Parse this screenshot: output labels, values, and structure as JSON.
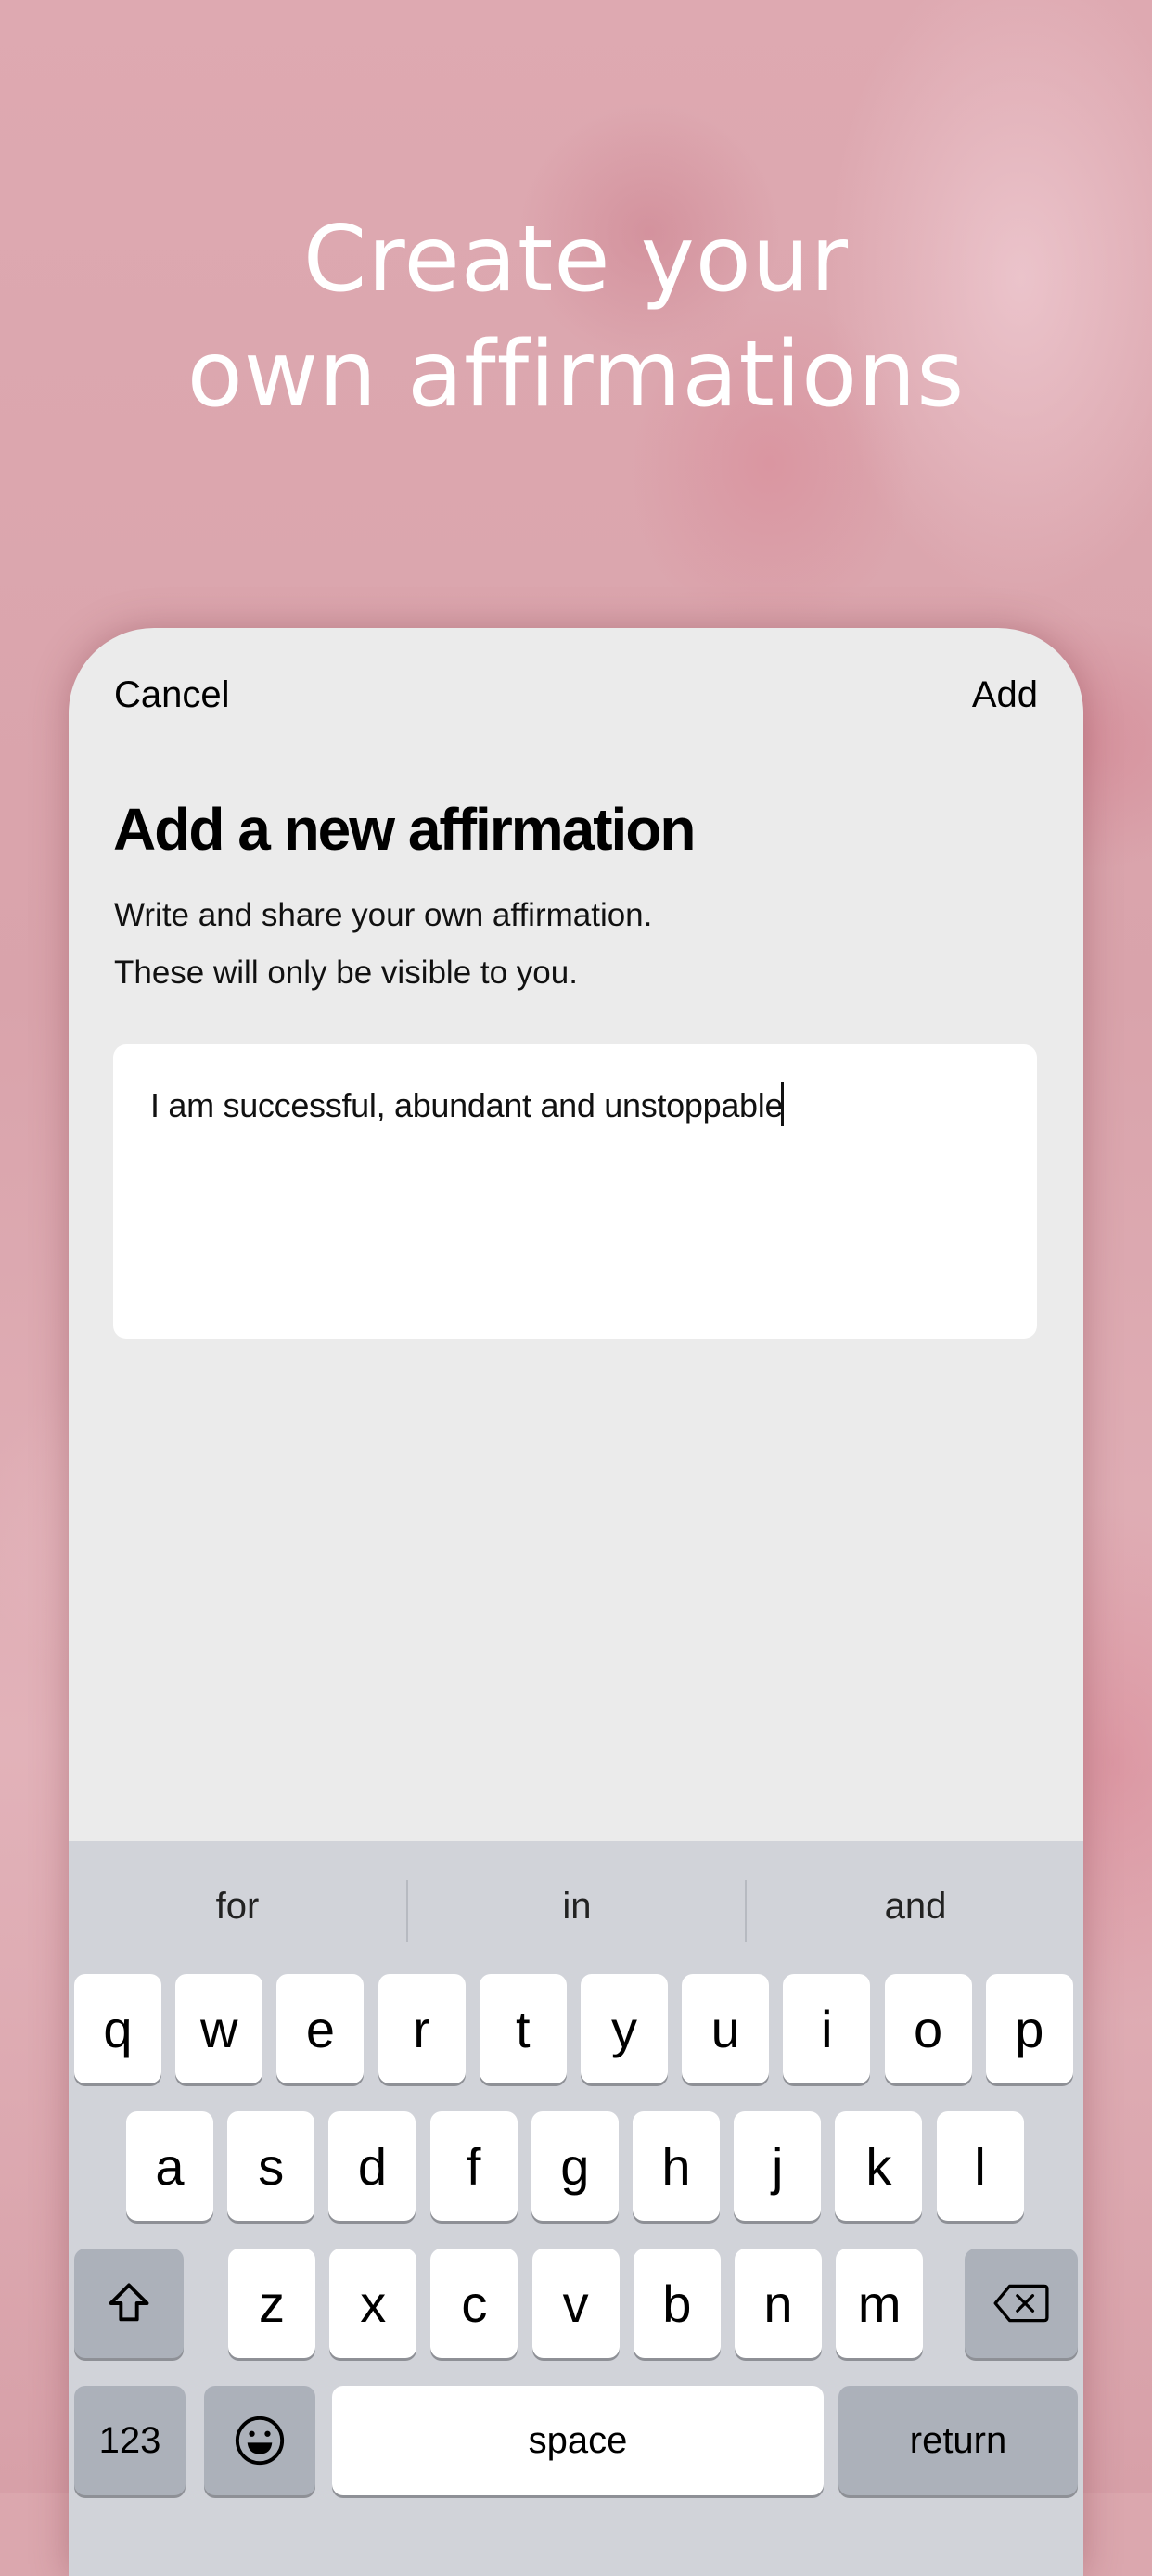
{
  "headline": {
    "line1": "Create your",
    "line2": "own affirmations"
  },
  "sheet": {
    "cancel_label": "Cancel",
    "add_label": "Add",
    "title": "Add a new affirmation",
    "subtitle_line1": "Write and share your own affirmation.",
    "subtitle_line2": "These will only be visible to you.",
    "input_value": "I am successful, abundant and unstoppable"
  },
  "keyboard": {
    "suggestions": [
      "for",
      "in",
      "and"
    ],
    "row1": [
      "q",
      "w",
      "e",
      "r",
      "t",
      "y",
      "u",
      "i",
      "o",
      "p"
    ],
    "row2": [
      "a",
      "s",
      "d",
      "f",
      "g",
      "h",
      "j",
      "k",
      "l"
    ],
    "row3": [
      "z",
      "x",
      "c",
      "v",
      "b",
      "n",
      "m"
    ],
    "shift_icon": "shift-icon",
    "delete_icon": "backspace-icon",
    "numbers_label": "123",
    "emoji_icon": "emoji-icon",
    "space_label": "space",
    "return_label": "return"
  },
  "colors": {
    "card_bg": "#ebebeb",
    "keyboard_bg": "#d1d3d9",
    "key_bg": "#ffffff",
    "fn_key_bg": "#acb1ba",
    "background_pink": "#dba7ae"
  }
}
